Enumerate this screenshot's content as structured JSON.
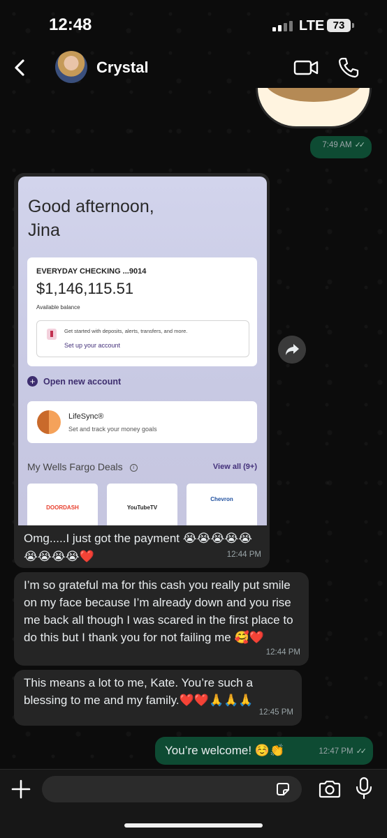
{
  "status_bar": {
    "time": "12:48",
    "network": "LTE",
    "battery": "73"
  },
  "header": {
    "contact_name": "Crystal"
  },
  "messages": {
    "m1": {
      "time": "7:49 AM"
    },
    "m2": {
      "screenshot": {
        "greeting_line1": "Good afternoon,",
        "greeting_line2": "Jina",
        "account_name": "EVERYDAY CHECKING ...9014",
        "balance": "$1,146,115.51",
        "balance_label": "Available balance",
        "setup_text": "Get started with deposits, alerts, transfers, and more.",
        "setup_link": "Set up your account",
        "open_account": "Open new account",
        "lifesync_title": "LifeSync®",
        "lifesync_sub": "Set and track your money goals",
        "deals_title": "My Wells Fargo Deals",
        "view_all": "View all (9+)",
        "deals": [
          "DOORDASH",
          "YouTubeTV",
          "Chevron"
        ]
      },
      "text": "Omg.....I just got the payment 😭😭😭😭😭😭😭😭😭❤️",
      "time": "12:44 PM"
    },
    "m3": {
      "text": "I’m so grateful ma for this cash you really put smile on my face because I’m already down and you rise me back all though I was scared in the first place to do this but I thank you for not failing me 🥰❤️",
      "time": "12:44 PM"
    },
    "m4": {
      "text": "This means a lot to me, Kate. You’re such a blessing to me and my family.❤️❤️🙏🙏🙏",
      "time": "12:45 PM"
    },
    "m5": {
      "text": "You’re welcome! ☺️👏",
      "time": "12:47 PM"
    }
  },
  "colors": {
    "incoming": "#252525",
    "outgoing": "#0e4b33",
    "background": "#0b0b0b"
  }
}
